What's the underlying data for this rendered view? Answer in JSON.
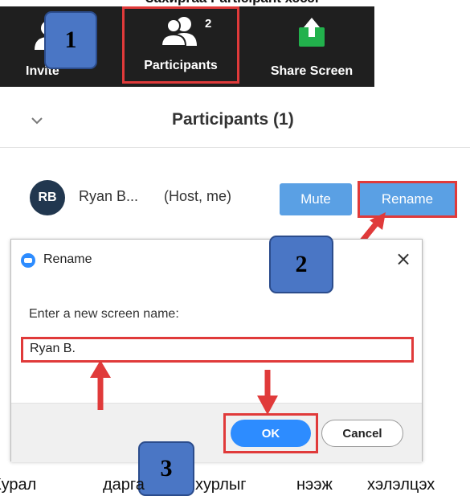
{
  "top_caption": "Захиргаа Participant хэсэг",
  "toolbar": {
    "invite_label": "Invite",
    "participants_label": "Participants",
    "participants_count": "2",
    "share_label": "Share Screen"
  },
  "callouts": {
    "one": "1",
    "two": "2",
    "three": "3"
  },
  "panel": {
    "title": "Participants (1)",
    "participant": {
      "initials": "RB",
      "name": "Ryan B...",
      "role": "(Host, me)",
      "mute_label": "Mute",
      "rename_label": "Rename"
    }
  },
  "dialog": {
    "title": "Rename",
    "close_glyph": "×",
    "prompt": "Enter a new screen name:",
    "input_value": "Ryan B.",
    "ok_label": "OK",
    "cancel_label": "Cancel"
  },
  "bottom_caption": {
    "w1": "Курал",
    "w2": "дарга",
    "w3": "хурлыг",
    "w4": "нээж",
    "w5": "хэлэлцэх"
  },
  "colors": {
    "toolbar_bg": "#1f1f1f",
    "highlight_red": "#e03a3a",
    "callout_blue": "#4a76c5",
    "zoom_blue": "#2d8cff",
    "button_blue": "#5aa0e4",
    "share_green": "#22b14c"
  }
}
